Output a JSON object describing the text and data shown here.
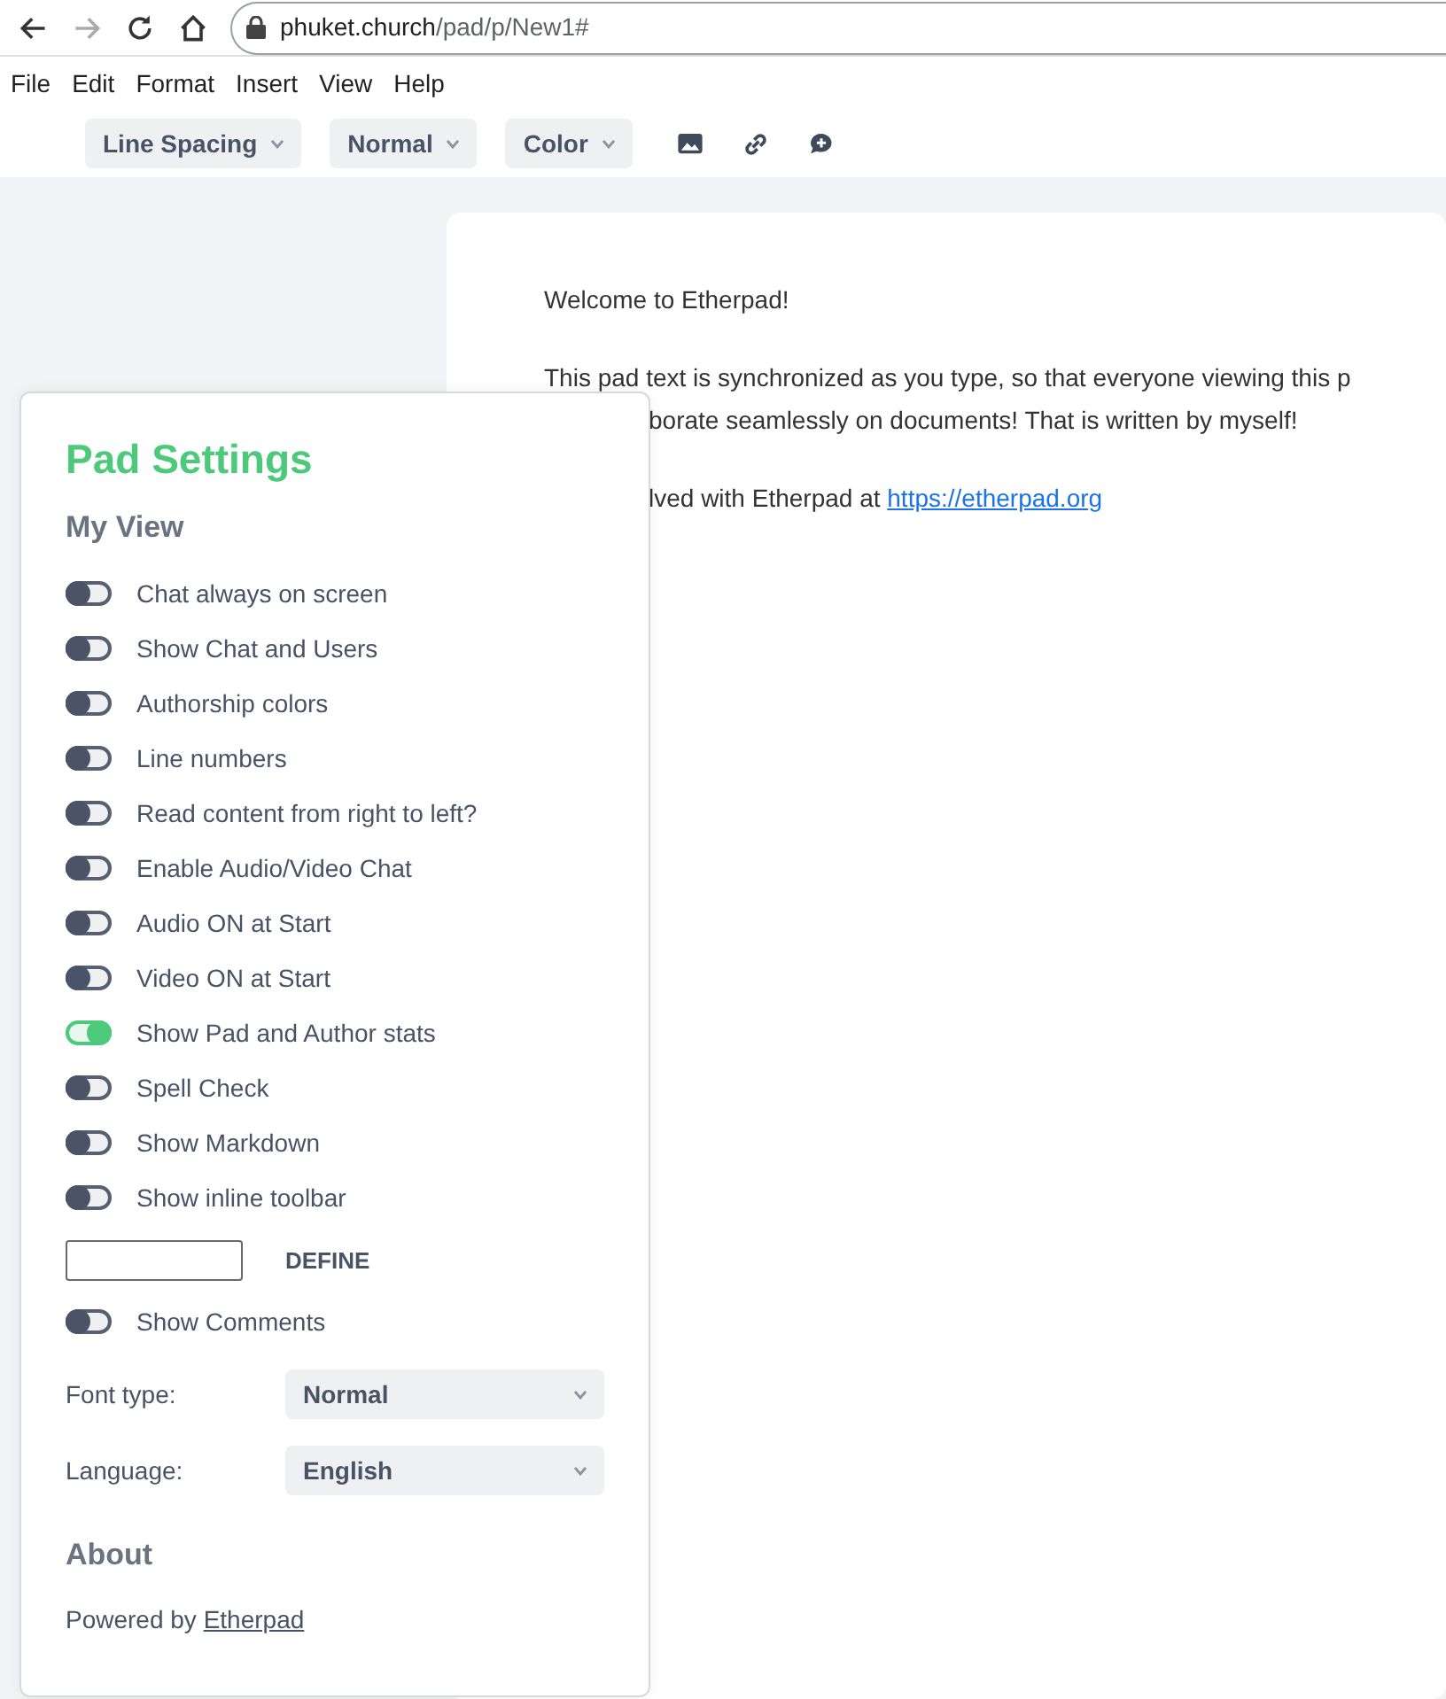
{
  "browser": {
    "url_host": "phuket.church",
    "url_path": "/pad/p/New1#"
  },
  "menu": [
    "File",
    "Edit",
    "Format",
    "Insert",
    "View",
    "Help"
  ],
  "toolbar": {
    "selects": [
      "Line Spacing",
      "Normal",
      "Color"
    ]
  },
  "pad": {
    "lines": [
      {
        "kind": "paragraph",
        "text": "Welcome to Etherpad!"
      },
      {
        "kind": "paragraph",
        "text": "This pad text is synchronized as you type, so that everyone viewing this p"
      },
      {
        "kind": "wrapped_hidden",
        "text": "borate seamlessly on documents! That is written by myself!"
      },
      {
        "kind": "paragraph_hidden",
        "text": "lved with Etherpad at ",
        "link": "https://etherpad.org"
      }
    ]
  },
  "settings": {
    "title": "Pad Settings",
    "section": "My View",
    "toggles": [
      {
        "label": "Chat always on screen",
        "on": false
      },
      {
        "label": "Show Chat and Users",
        "on": false
      },
      {
        "label": "Authorship colors",
        "on": false
      },
      {
        "label": "Line numbers",
        "on": false
      },
      {
        "label": "Read content from right to left?",
        "on": false
      },
      {
        "label": "Enable Audio/Video Chat",
        "on": false
      },
      {
        "label": "Audio ON at Start",
        "on": false
      },
      {
        "label": "Video ON at Start",
        "on": false
      },
      {
        "label": "Show Pad and Author stats",
        "on": true
      },
      {
        "label": "Spell Check",
        "on": false
      },
      {
        "label": "Show Markdown",
        "on": false
      },
      {
        "label": "Show inline toolbar",
        "on": false
      }
    ],
    "define_button": "DEFINE",
    "comments_toggle": {
      "label": "Show Comments",
      "on": false
    },
    "selects": [
      {
        "label": "Font type:",
        "value": "Normal"
      },
      {
        "label": "Language:",
        "value": "English"
      }
    ],
    "about_title": "About",
    "powered_text": "Powered by ",
    "powered_link": "Etherpad"
  }
}
